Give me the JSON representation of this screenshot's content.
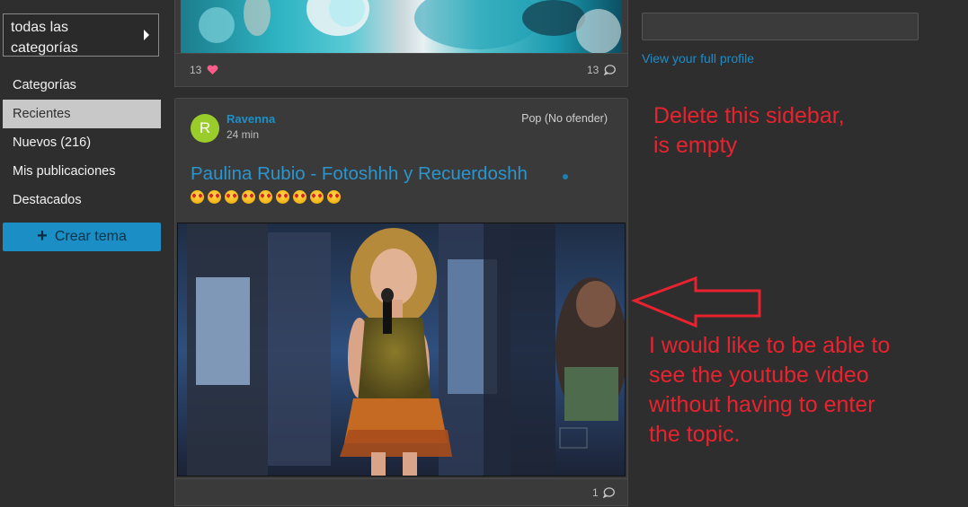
{
  "sidebar": {
    "category_select": "todas las categorías",
    "nav": [
      {
        "label": "Categorías"
      },
      {
        "label": "Recientes"
      },
      {
        "label": "Nuevos (216)"
      },
      {
        "label": "Mis publicaciones"
      },
      {
        "label": "Destacados"
      }
    ],
    "create_button": "Crear tema"
  },
  "feed": {
    "top_card": {
      "likes": "13",
      "replies": "13"
    },
    "post": {
      "avatar_letter": "R",
      "author": "Ravenna",
      "age": "24 min",
      "category": "Pop (No ofender)",
      "title": "Paulina Rubio - Fotoshhh y Recuerdoshh",
      "emoji_count": 9,
      "replies": "1"
    }
  },
  "profile": {
    "link": "View your full profile"
  },
  "annotations": {
    "note1_line1": "Delete this sidebar,",
    "note1_line2": "is empty",
    "note2_line1": "I would like to be able to",
    "note2_line2": "see the youtube video",
    "note2_line3": "without having to enter",
    "note2_line4": "the topic."
  },
  "colors": {
    "accent": "#1b8ec5",
    "link": "#2b95cd",
    "annotation": "#e8232f",
    "avatar": "#9acd2b",
    "heart": "#ff5c8a"
  }
}
